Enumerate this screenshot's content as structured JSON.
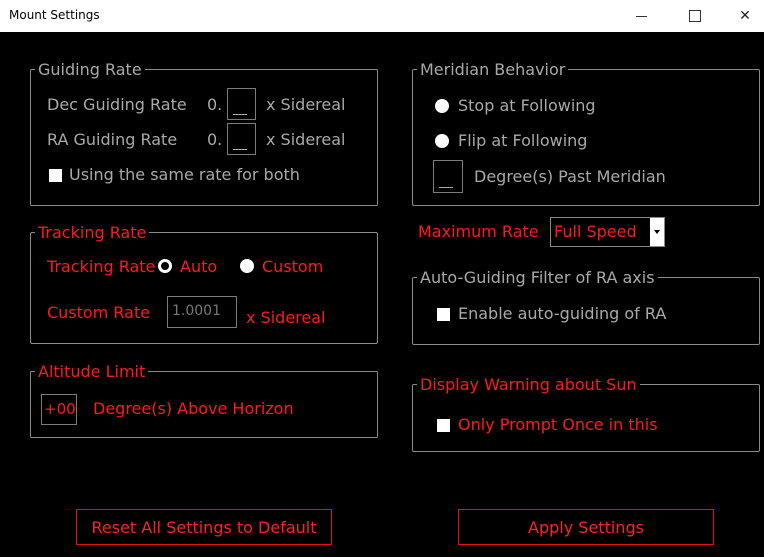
{
  "window": {
    "title": "Mount Settings"
  },
  "guiding": {
    "legend": "Guiding Rate",
    "dec_label": "Dec Guiding Rate",
    "dec_prefix": "0.",
    "dec_suffix": "x Sidereal",
    "ra_label": "RA Guiding Rate",
    "ra_prefix": "0.",
    "ra_suffix": "x Sidereal",
    "same_rate_label": "Using the same rate for both"
  },
  "tracking": {
    "legend": "Tracking Rate",
    "rate_label": "Tracking Rate",
    "auto_label": "Auto",
    "custom_label": "Custom",
    "custom_rate_label": "Custom Rate",
    "custom_rate_value": "1.0001",
    "custom_rate_suffix": "x Sidereal"
  },
  "altitude": {
    "legend": "Altitude Limit",
    "value": "+00",
    "suffix": "Degree(s) Above Horizon"
  },
  "meridian": {
    "legend": "Meridian Behavior",
    "stop_label": "Stop at Following",
    "flip_label": "Flip at Following",
    "past_label": "Degree(s) Past Meridian"
  },
  "max_rate": {
    "label": "Maximum Rate",
    "selected": "Full Speed"
  },
  "autoguide": {
    "legend": "Auto-Guiding Filter of RA axis",
    "enable_label": "Enable auto-guiding of RA"
  },
  "sun": {
    "legend": "Display Warning about Sun",
    "prompt_label": "Only Prompt Once in this"
  },
  "buttons": {
    "reset": "Reset All Settings to Default",
    "apply": "Apply Settings"
  },
  "colors": {
    "accent": "#ff1a1a",
    "muted": "#a9a9a9",
    "background": "#000000"
  }
}
